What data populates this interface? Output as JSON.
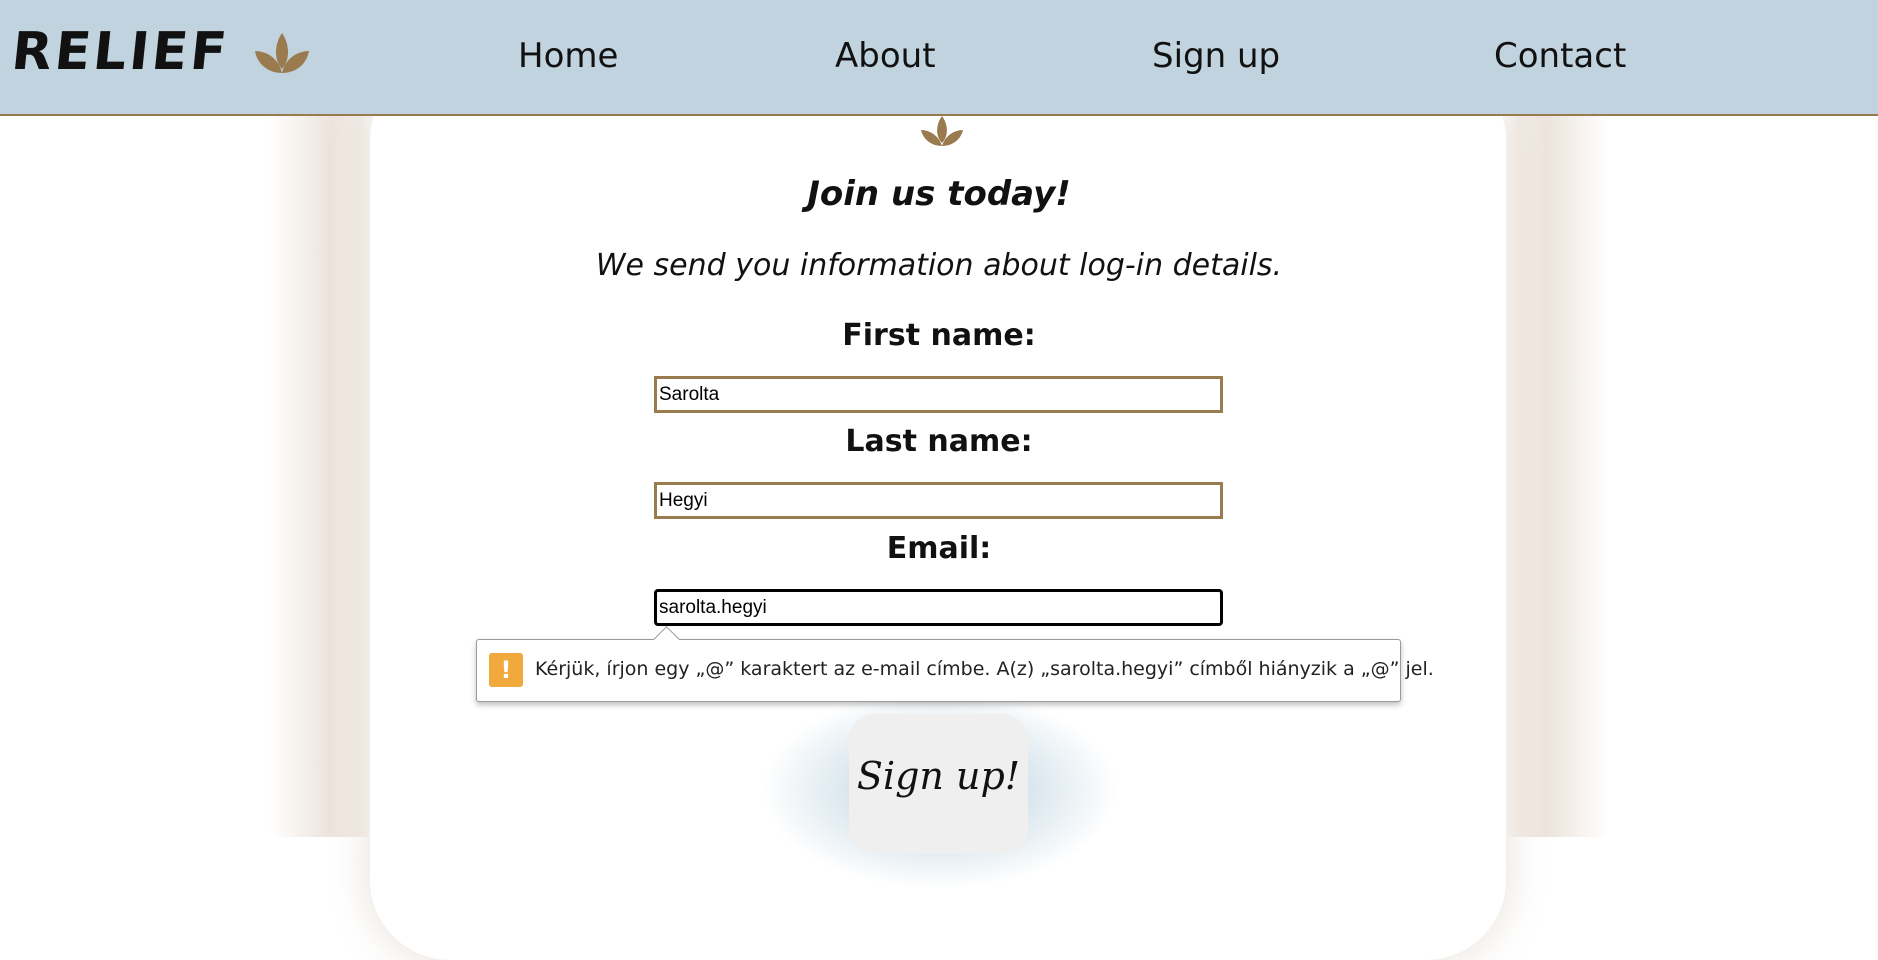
{
  "brand": {
    "name": "RELIEF",
    "logo_icon": "lotus-leaves-icon"
  },
  "nav": {
    "items": [
      {
        "label": "Home"
      },
      {
        "label": "About"
      },
      {
        "label": "Sign up"
      },
      {
        "label": "Contact"
      }
    ]
  },
  "form": {
    "card_icon": "lotus-leaves-icon",
    "title": "Join us today!",
    "subtitle": "We send you information about log-in details.",
    "first_name": {
      "label": "First name:",
      "value": "Sarolta"
    },
    "last_name": {
      "label": "Last name:",
      "value": "Hegyi"
    },
    "email": {
      "label": "Email:",
      "value": "sarolta.hegyi"
    },
    "validation": {
      "icon": "warning-icon",
      "icon_glyph": "!",
      "message": "Kérjük, írjon egy „@” karaktert az e-mail címbe. A(z) „sarolta.hegyi” címből hiányzik a „@” jel."
    },
    "submit_label": "Sign up!"
  },
  "colors": {
    "navbar_bg": "#c1d3de",
    "accent_brown": "#9a7b50",
    "warning_orange": "#f2a93b"
  }
}
